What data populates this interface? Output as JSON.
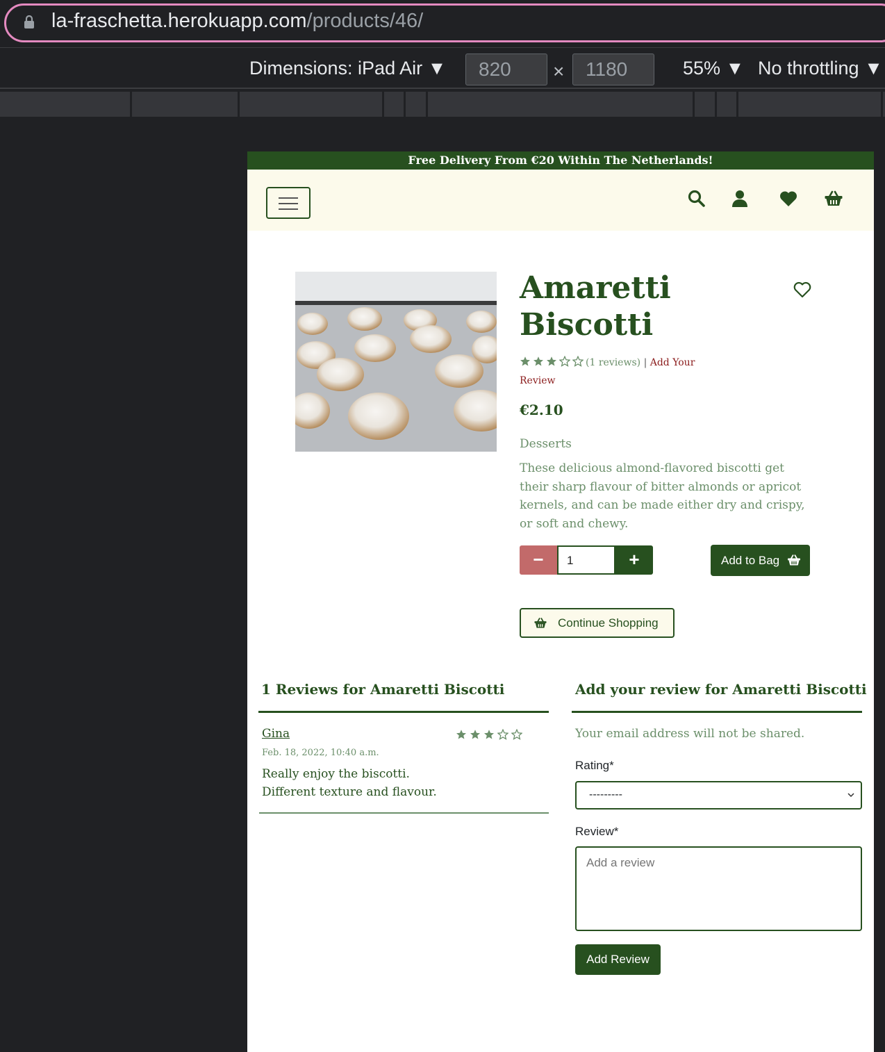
{
  "browser": {
    "url_host": "la-fraschetta.herokuapp.com",
    "url_path": "/products/46/"
  },
  "devtools": {
    "dimensions_label": "Dimensions: iPad Air ▼",
    "width": "820",
    "height": "1180",
    "times": "×",
    "zoom": "55% ▼",
    "throttling": "No throttling ▼"
  },
  "site": {
    "banner": "Free Delivery From €20 Within The Netherlands!",
    "nav_icons": [
      "menu-icon",
      "search-icon",
      "user-icon",
      "heart-icon",
      "basket-icon"
    ],
    "brand_color": "#27501f",
    "accent_color": "#c26a6a"
  },
  "product": {
    "title_line1": "Amaretti",
    "title_line2": "Biscotti",
    "rating": 3,
    "rating_max": 5,
    "reviews_count_text": "(1 reviews)",
    "separator": "|",
    "add_review_link": "Add Your Review",
    "price": "€2.10",
    "category": "Desserts",
    "description": "These delicious almond-flavored biscotti get their sharp flavour of bitter almonds or apricot kernels, and can be made either dry and crispy, or soft and chewy.",
    "quantity": "1",
    "minus_label": "−",
    "plus_label": "+",
    "add_to_bag": "Add to Bag",
    "continue_shopping": "Continue Shopping"
  },
  "reviews": {
    "heading": "1 Reviews for Amaretti Biscotti",
    "items": [
      {
        "author": "Gina",
        "rating": 3,
        "date": "Feb. 18, 2022, 10:40 a.m.",
        "line1": "Really enjoy the biscotti.",
        "line2": "Different texture and flavour."
      }
    ]
  },
  "review_form": {
    "heading": "Add your review for Amaretti Biscotti",
    "email_note": "Your email address will not be shared.",
    "rating_label": "Rating*",
    "rating_value": "---------",
    "review_label": "Review*",
    "review_placeholder": "Add a review",
    "submit": "Add Review"
  }
}
